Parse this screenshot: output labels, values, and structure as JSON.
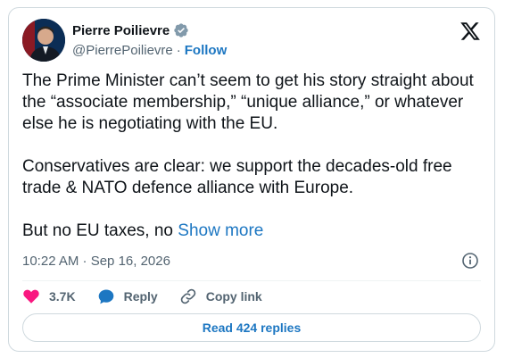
{
  "author": {
    "display_name": "Pierre Poilievre",
    "handle": "@PierrePoilievre",
    "separator": "·",
    "follow_label": "Follow",
    "verified": true,
    "verified_color": "#829aab"
  },
  "brand": {
    "logo": "x-logo-icon"
  },
  "tweet": {
    "paragraphs": [
      "The Prime Minister can’t seem to get his story straight about the “associate membership,” “unique alliance,” or whatever else he is negotiating with the EU.",
      "Conservatives are clear: we support the decades-old free trade & NATO defence alliance with Europe."
    ],
    "truncated_text": "But no EU taxes, no ",
    "show_more_label": "Show more"
  },
  "meta": {
    "timestamp": "10:22 AM · Sep 16, 2026",
    "info_icon": "info-icon"
  },
  "actions": {
    "like_count": "3.7K",
    "reply_label": "Reply",
    "copy_link_label": "Copy link"
  },
  "replies": {
    "read_label": "Read 424 replies"
  },
  "colors": {
    "accent": "#1d77c2",
    "heart": "#f91880",
    "text": "#0f1419",
    "muted": "#536471",
    "border": "#cfd9de"
  }
}
